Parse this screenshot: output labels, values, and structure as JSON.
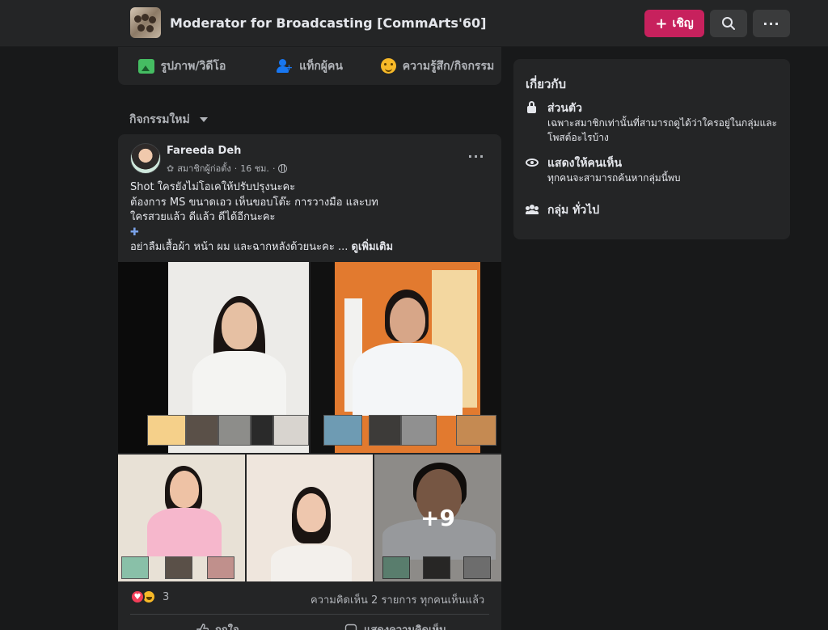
{
  "header": {
    "group_title": "Moderator for Broadcasting [CommArts'60]",
    "invite_label": "เชิญ",
    "invite_plus": "+",
    "more_label": "···"
  },
  "composer": {
    "photo_label": "รูปภาพ/วิดีโอ",
    "tag_label": "แท็กผู้คน",
    "feeling_label": "ความรู้สึก/กิจกรรม"
  },
  "sort": {
    "label": "กิจกรรมใหม่"
  },
  "post": {
    "author": "Fareeda Deh",
    "role": "สมาชิกผู้ก่อตั้ง",
    "time": "16 ชม.",
    "more_label": "···",
    "lines": [
      "Shot ใครยังไม่โอเคให้ปรับปรุงนะคะ",
      "ต้องการ MS ขนาดเอว เห็นขอบโต๊ะ การวางมือ และบท",
      "ใครสวยแล้ว ดีแล้ว ดีได้อีกนะคะ"
    ],
    "puzzle_icon": "puzzle-piece-icon",
    "last_line": "อย่าลืมเสื้อผ้า หน้า ผม และฉากหลังด้วยนะคะ ...",
    "see_more": "ดูเพิ่มเติม",
    "photo_overflow": "+9",
    "reaction_count": "3",
    "comments_text": "ความคิดเห็น 2 รายการ",
    "seen_text": "ทุกคนเห็นแล้ว",
    "like_label": "ถูกใจ",
    "comment_label": "แสดงความคิดเห็น",
    "colors": {
      "love": "#f33e58",
      "haha": "#f7b928"
    }
  },
  "about": {
    "title": "เกี่ยวกับ",
    "private_title": "ส่วนตัว",
    "private_desc": "เฉพาะสมาชิกเท่านั้นที่สามารถดูได้ว่าใครอยู่ในกลุ่มและโพสต์อะไรบ้าง",
    "visible_title": "แสดงให้คนเห็น",
    "visible_desc": "ทุกคนจะสามารถค้นหากลุ่มนี้พบ",
    "general_label": "กลุ่ม ทั่วไป"
  },
  "colors": {
    "background": "#18191a",
    "surface": "#242526",
    "invite_button": "#c7215d",
    "icon_button": "#3a3b3c"
  }
}
